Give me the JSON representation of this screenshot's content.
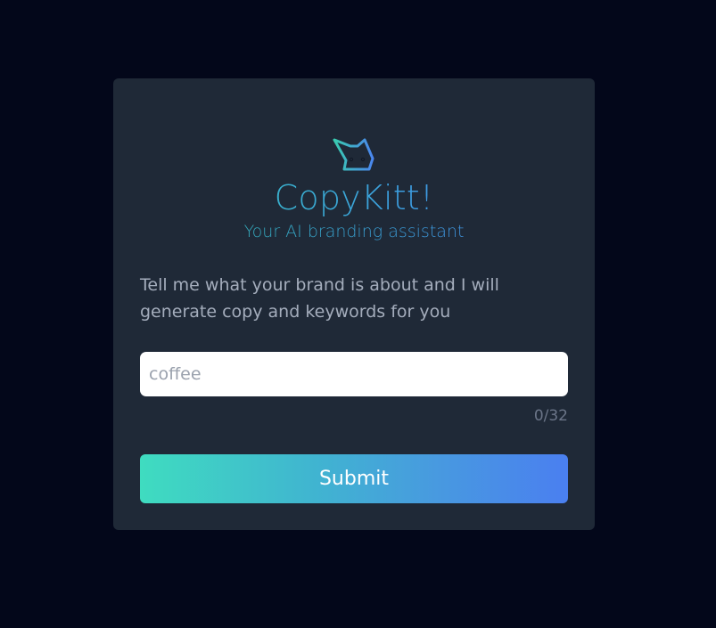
{
  "app": {
    "title": "CopyKitt!",
    "subtitle": "Your AI branding assistant",
    "logo_icon": "cat-head-icon"
  },
  "prompt": {
    "description": "Tell me what your brand is about and I will generate copy and keywords for you"
  },
  "form": {
    "input_value": "coffee",
    "input_placeholder": "coffee",
    "char_count": "0/32",
    "submit_label": "Submit"
  },
  "colors": {
    "page_bg": "#03071a",
    "card_bg": "#1f2937",
    "gradient_start": "#3fdcc0",
    "gradient_end": "#4a7ff0"
  }
}
